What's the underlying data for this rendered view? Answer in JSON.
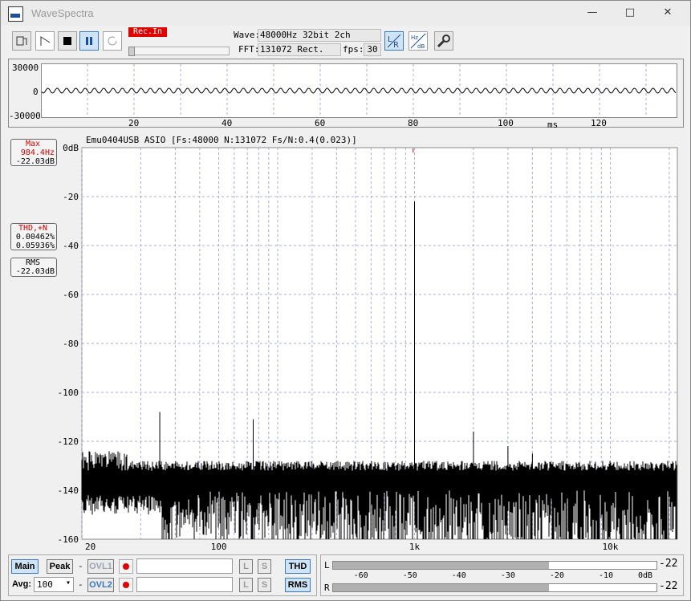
{
  "window": {
    "title": "WaveSpectra",
    "minimize": "—",
    "maximize": "□",
    "close": "✕"
  },
  "toolbar": {
    "rec_in": "Rec.In",
    "wave_label": "Wave:",
    "wave_value": "48000Hz 32bit 2ch",
    "fft_label": "FFT:",
    "fft_value": "131072 Rect.",
    "fps_label": "fps:",
    "fps_value": "30",
    "icons": [
      "open-file-icon",
      "play-icon",
      "stop-icon",
      "pause-icon",
      "refresh-icon",
      "lr-channel-icon",
      "hz-db-icon",
      "settings-wrench-icon"
    ]
  },
  "wave": {
    "y_ticks": [
      "30000",
      "0",
      "-30000"
    ],
    "x_ticks": [
      "20",
      "40",
      "60",
      "80",
      "100",
      "120"
    ],
    "x_unit": "ms"
  },
  "readouts": {
    "max_label": "Max",
    "max_freq": "984.4Hz",
    "max_db": "-22.03dB",
    "thd_label": "THD,+N",
    "thd_value": "0.00462%",
    "thdn_value": "0.05936%",
    "rms_label": "RMS",
    "rms_value": "-22.03dB"
  },
  "spectrum_header": "Emu0404USB ASIO   [Fs:48000  N:131072  Fs/N:0.4(0.023)]",
  "chart_data": {
    "type": "line",
    "y_ticks": [
      "0dB",
      "-20",
      "-40",
      "-60",
      "-80",
      "-100",
      "-120",
      "-140",
      "-160"
    ],
    "x_ticks": [
      "20",
      "100",
      "1k",
      "10k"
    ],
    "x_scale": "log",
    "xlim": [
      20,
      22000
    ],
    "ylim": [
      -160,
      0
    ],
    "grid": true,
    "peaks": [
      {
        "x": 1000,
        "y": -22
      },
      {
        "x": 50,
        "y": -108
      },
      {
        "x": 150,
        "y": -111
      },
      {
        "x": 2000,
        "y": -116
      },
      {
        "x": 3000,
        "y": -122
      },
      {
        "x": 4000,
        "y": -125
      }
    ],
    "noise_floor_db": -136,
    "line_color": "#000000"
  },
  "bottom": {
    "main": "Main",
    "peak": "Peak",
    "ovl1": "OVL1",
    "ovl2": "OVL2",
    "avg_label": "Avg:",
    "avg_value": "100",
    "dash": "-",
    "l": "L",
    "s": "S",
    "thd": "THD",
    "rms": "RMS",
    "meter_ticks": [
      "-60",
      "-50",
      "-40",
      "-30",
      "-20",
      "-10",
      "0dB"
    ],
    "meter_l_label": "L",
    "meter_r_label": "R",
    "meter_l_value": "-22",
    "meter_r_value": "-22",
    "meter_level_db": -22
  },
  "colors": {
    "accent": "#1a4fa0",
    "rec": "#e00000",
    "grid": "#a9a9d8"
  }
}
